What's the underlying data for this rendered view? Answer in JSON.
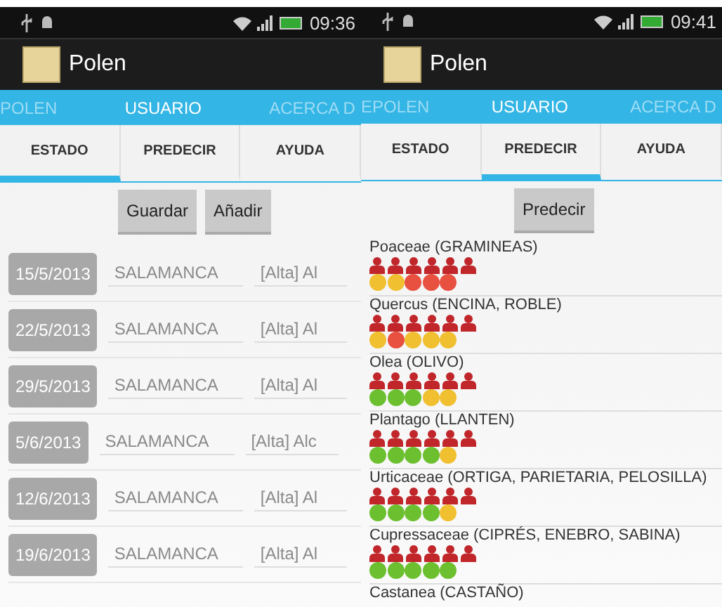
{
  "phones": [
    {
      "kind": "estado",
      "status_bar": {
        "time": "09:36"
      },
      "app_title": "Polen",
      "top_tabs": [
        {
          "label": "POLEN",
          "selected": false
        },
        {
          "label": "USUARIO",
          "selected": true
        },
        {
          "label": "ACERCA D",
          "selected": false
        }
      ],
      "tabs": [
        {
          "label": "ESTADO",
          "selected": true
        },
        {
          "label": "PREDECIR",
          "selected": false
        },
        {
          "label": "AYUDA",
          "selected": false
        }
      ],
      "buttons": [
        "Guardar",
        "Añadir"
      ],
      "rows": [
        {
          "date": "15/5/2013",
          "city": "SALAMANCA",
          "alert": "[Alta] Al"
        },
        {
          "date": "22/5/2013",
          "city": "SALAMANCA",
          "alert": "[Alta] Al"
        },
        {
          "date": "29/5/2013",
          "city": "SALAMANCA",
          "alert": "[Alta] Al"
        },
        {
          "date": "5/6/2013",
          "city": "SALAMANCA",
          "alert": "[Alta] Alc"
        },
        {
          "date": "12/6/2013",
          "city": "SALAMANCA",
          "alert": "[Alta] Al"
        },
        {
          "date": "19/6/2013",
          "city": "SALAMANCA",
          "alert": "[Alta] Al"
        }
      ]
    },
    {
      "kind": "predecir",
      "status_bar": {
        "time": "09:41"
      },
      "app_title": "Polen",
      "top_tabs": [
        {
          "label": "EPOLEN",
          "selected": false
        },
        {
          "label": "USUARIO",
          "selected": true
        },
        {
          "label": "ACERCA D",
          "selected": false
        }
      ],
      "tabs": [
        {
          "label": "ESTADO",
          "selected": false
        },
        {
          "label": "PREDECIR",
          "selected": true
        },
        {
          "label": "AYUDA",
          "selected": false
        }
      ],
      "buttons": [
        "Predecir"
      ],
      "pollens": [
        {
          "name": "Poaceae (GRAMINEAS)",
          "circles": [
            {
              "color": "#f0c030"
            },
            {
              "color": "#f0c030"
            },
            {
              "color": "#e85040"
            },
            {
              "color": "#e85040"
            },
            {
              "color": "#e85040"
            }
          ]
        },
        {
          "name": "Quercus (ENCINA, ROBLE)",
          "circles": [
            {
              "color": "#f0c030"
            },
            {
              "color": "#e85040"
            },
            {
              "color": "#f0c030"
            },
            {
              "color": "#f0c030"
            },
            {
              "color": "#f0c030"
            }
          ]
        },
        {
          "name": "Olea (OLIVO)",
          "circles": [
            {
              "color": "#6cc030"
            },
            {
              "color": "#6cc030"
            },
            {
              "color": "#6cc030"
            },
            {
              "color": "#f0c030"
            },
            {
              "color": "#f0c030"
            }
          ]
        },
        {
          "name": "Plantago (LLANTEN)",
          "circles": [
            {
              "color": "#6cc030"
            },
            {
              "color": "#6cc030"
            },
            {
              "color": "#6cc030"
            },
            {
              "color": "#6cc030"
            },
            {
              "color": "#f0c030"
            }
          ]
        },
        {
          "name": "Urticaceae (ORTIGA, PARIETARIA, PELOSILLA)",
          "circles": [
            {
              "color": "#6cc030"
            },
            {
              "color": "#6cc030"
            },
            {
              "color": "#6cc030"
            },
            {
              "color": "#6cc030"
            },
            {
              "color": "#f0c030"
            }
          ]
        },
        {
          "name": "Cupressaceae (CIPRÉS, ENEBRO, SABINA)",
          "circles": [
            {
              "color": "#6cc030"
            },
            {
              "color": "#6cc030"
            },
            {
              "color": "#6cc030"
            },
            {
              "color": "#6cc030"
            },
            {
              "color": "#6cc030"
            }
          ]
        },
        {
          "name": "Castanea (CASTAÑO)"
        }
      ]
    }
  ]
}
